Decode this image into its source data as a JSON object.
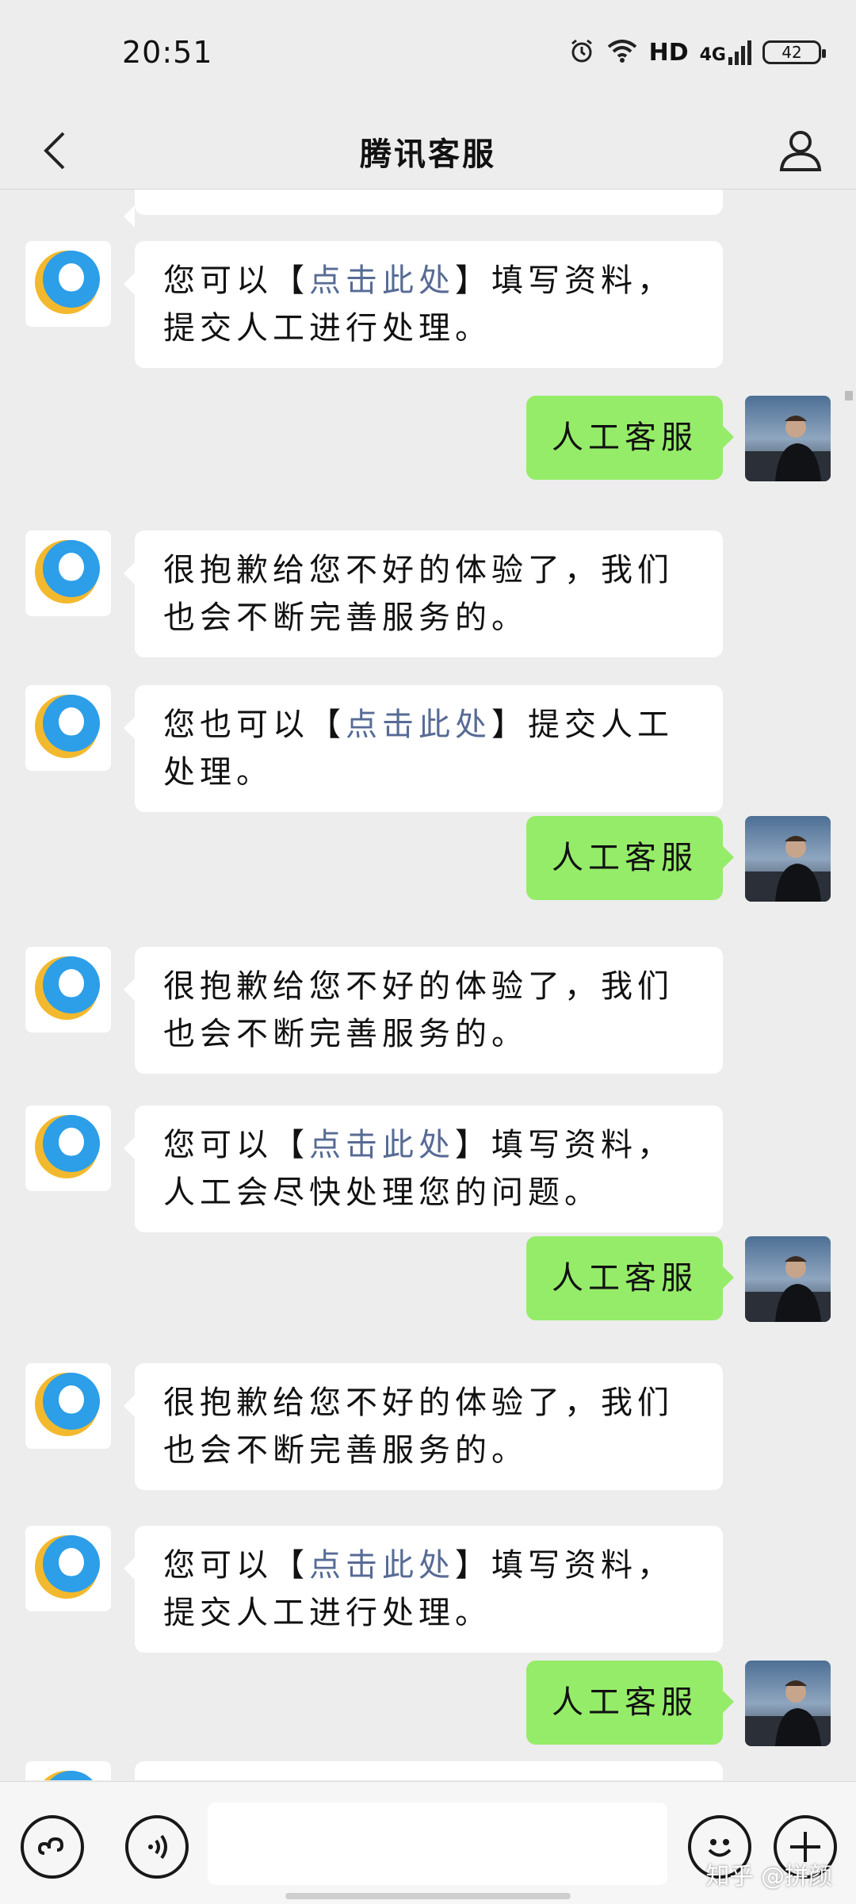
{
  "status_bar": {
    "time": "20:51",
    "network_label": "HD",
    "signal_label": "4G",
    "battery_level": "42"
  },
  "header": {
    "title": "腾讯客服"
  },
  "chat": {
    "messages": [
      {
        "side": "left",
        "parts": [
          "您可以【",
          "点击此处",
          "】填写资料，提交人工进行处理。"
        ]
      },
      {
        "side": "right",
        "text": "人工客服"
      },
      {
        "side": "left",
        "text": "很抱歉给您不好的体验了，我们也会不断完善服务的。"
      },
      {
        "side": "left",
        "parts": [
          "您也可以【",
          "点击此处",
          "】提交人工处理。"
        ]
      },
      {
        "side": "right",
        "text": "人工客服"
      },
      {
        "side": "left",
        "text": "很抱歉给您不好的体验了，我们也会不断完善服务的。"
      },
      {
        "side": "left",
        "parts": [
          "您可以【",
          "点击此处",
          "】填写资料，人工会尽快处理您的问题。"
        ]
      },
      {
        "side": "right",
        "text": "人工客服"
      },
      {
        "side": "left",
        "text": "很抱歉给您不好的体验了，我们也会不断完善服务的。"
      },
      {
        "side": "left",
        "parts": [
          "您可以【",
          "点击此处",
          "】填写资料，提交人工进行处理。"
        ]
      },
      {
        "side": "right",
        "text": "人工客服"
      }
    ]
  },
  "input_bar": {
    "value": "",
    "watermark": "知乎 @拼颜"
  },
  "colors": {
    "background": "#ededed",
    "bubble_sent": "#95ec69",
    "bubble_received": "#ffffff",
    "link": "#576b95"
  },
  "icons": [
    "back-arrow",
    "user-profile",
    "mini-program",
    "voice",
    "emoji",
    "plus"
  ]
}
